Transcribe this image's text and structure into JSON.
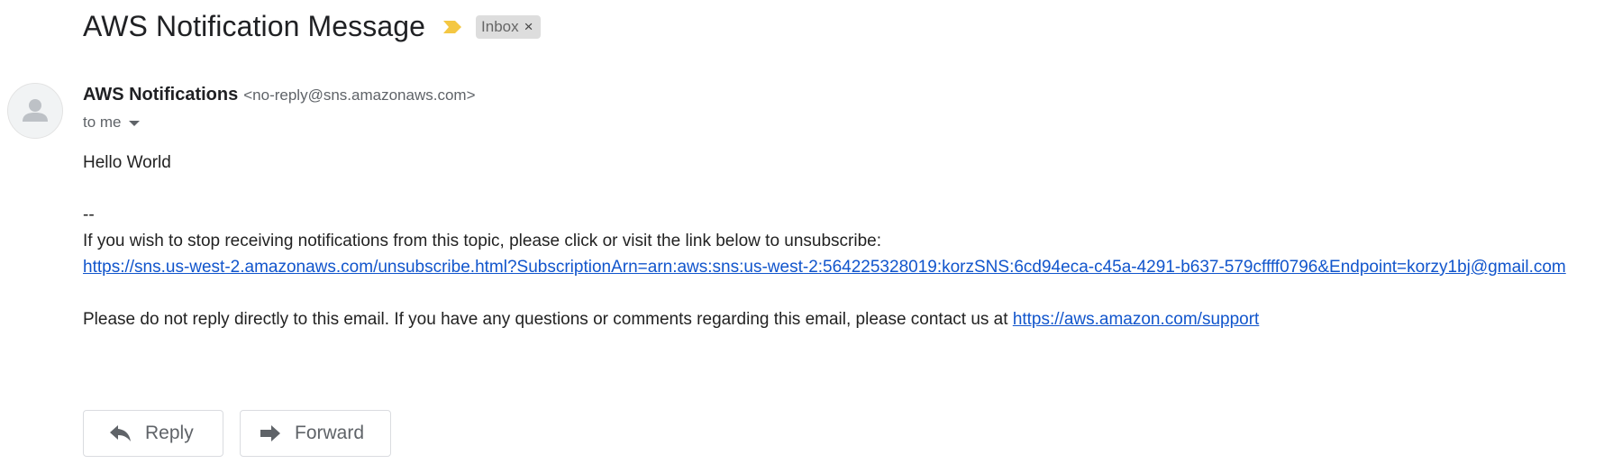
{
  "email": {
    "subject": "AWS Notification Message",
    "label": "Inbox",
    "label_close": "×",
    "sender_name": "AWS Notifications",
    "sender_email": "<no-reply@sns.amazonaws.com>",
    "recipient": "to me"
  },
  "body": {
    "greeting": "Hello World",
    "separator": "--",
    "unsubscribe_text": "If you wish to stop receiving notifications from this topic, please click or visit the link below to unsubscribe:",
    "unsubscribe_link": "https://sns.us-west-2.amazonaws.com/unsubscribe.html?SubscriptionArn=arn:aws:sns:us-west-2:564225328019:korzSNS:6cd94eca-c45a-4291-b637-579cffff0796&Endpoint=korzy1bj@gmail.com",
    "contact_text": "Please do not reply directly to this email. If you have any questions or comments regarding this email, please contact us at ",
    "support_link": "https://aws.amazon.com/support"
  },
  "actions": {
    "reply_label": "Reply",
    "forward_label": "Forward"
  },
  "icons": {
    "importance": "importance-marker-icon",
    "avatar": "default-avatar-icon",
    "caret": "chevron-down-icon",
    "reply": "reply-arrow-icon",
    "forward": "forward-arrow-icon"
  },
  "colors": {
    "importance": "#F4C742",
    "link": "#1155CC",
    "chip_bg": "#DDDDDD"
  }
}
